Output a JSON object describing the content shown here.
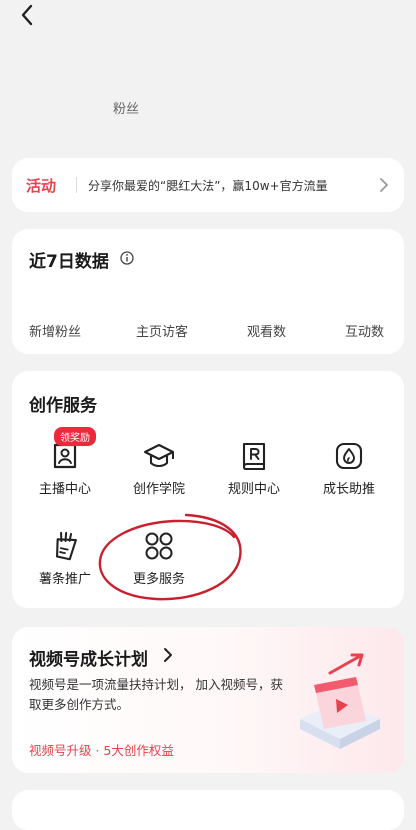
{
  "header": {
    "back_icon": "chevron-left-icon",
    "fans_label": "粉丝"
  },
  "activity": {
    "tag": "活动",
    "text": "分享你最爱的“腮红大法”，赢10w+官方流量",
    "arrow_icon": "chevron-right-icon"
  },
  "data_card": {
    "title": "近7日数据",
    "info_icon": "info-icon",
    "metrics": [
      "新增粉丝",
      "主页访客",
      "观看数",
      "互动数"
    ]
  },
  "services": {
    "title": "创作服务",
    "badge": "领奖励",
    "items": [
      {
        "label": "主播中心",
        "icon": "streamer-center-icon"
      },
      {
        "label": "创作学院",
        "icon": "graduation-cap-icon"
      },
      {
        "label": "规则中心",
        "icon": "rules-book-icon"
      },
      {
        "label": "成长助推",
        "icon": "flame-boost-icon"
      },
      {
        "label": "薯条推广",
        "icon": "fries-promo-icon"
      },
      {
        "label": "更多服务",
        "icon": "more-grid-icon"
      }
    ]
  },
  "growth": {
    "title": "视频号成长计划",
    "desc": "视频号是一项流量扶持计划， 加入视频号，获取更多创作方式。",
    "link": "视频号升级 · 5大创作权益",
    "accent": "#e8424d"
  },
  "colors": {
    "accent": "#e8424d",
    "badge": "#ec2a3c",
    "background": "#f2f2f2"
  }
}
